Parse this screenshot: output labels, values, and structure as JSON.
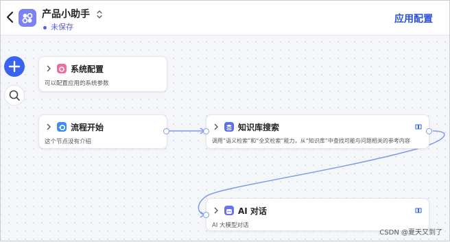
{
  "header": {
    "app_title": "产品小助手",
    "status": "未保存",
    "config_label": "应用配置"
  },
  "nodes": {
    "sys": {
      "title": "系统配置",
      "desc": "可以配置应用的系统参数",
      "icon": "settings-icon",
      "color": "#ef6da0"
    },
    "start": {
      "title": "流程开始",
      "desc": "这个节点没有介绍",
      "icon": "start-icon",
      "color": "#3c8df0"
    },
    "kb": {
      "title": "知识库搜索",
      "desc": "调用“语义检索”和“全文检索”能力，从“知识库”中查找可能与问题相关的参考内容",
      "icon": "database-icon",
      "color": "#5b6ef0"
    },
    "ai": {
      "title": "AI 对话",
      "desc": "AI 大模型对话",
      "icon": "ai-bot-icon",
      "color": "#6a70f5"
    }
  },
  "watermark": "CSDN @夏天又到了",
  "colors": {
    "accent": "#2b4fd6",
    "edge": "#7b9bea",
    "add_button": "#3a63f0"
  }
}
